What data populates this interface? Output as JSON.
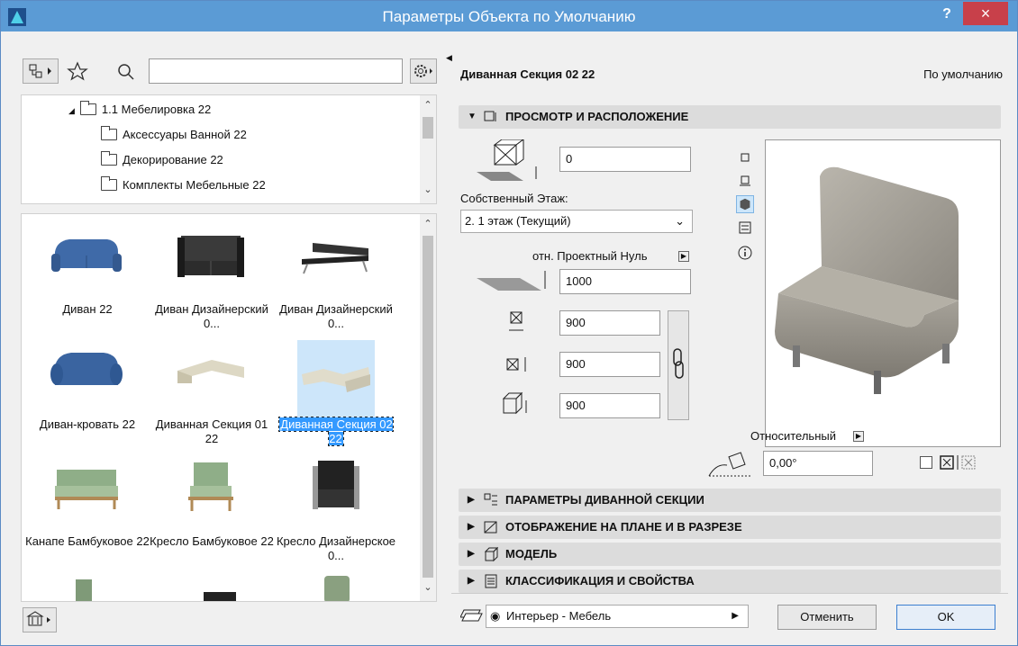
{
  "window": {
    "title": "Параметры Объекта по Умолчанию",
    "help": "?",
    "close": "×"
  },
  "library": {
    "search_value": "",
    "tree": [
      {
        "label": "1.1 Мебелировка 22",
        "expanded": true,
        "level": 0
      },
      {
        "label": "Аксессуары Ванной 22",
        "level": 1
      },
      {
        "label": "Декорирование 22",
        "level": 1
      },
      {
        "label": "Комплекты Мебельные 22",
        "level": 1
      }
    ],
    "items": [
      {
        "label": "Диван 22",
        "color": "#3f6aa8"
      },
      {
        "label": "Диван Дизайнерский 0...",
        "color": "#2c2c2c"
      },
      {
        "label": "Диван Дизайнерский 0...",
        "color": "#333333"
      },
      {
        "label": "Диван-кровать 22",
        "color": "#3a64a0"
      },
      {
        "label": "Диванная Секция 01 22",
        "color": "#ddd8c4"
      },
      {
        "label": "Диванная Секция 02 22",
        "color": "#e0dccb",
        "selected": true
      },
      {
        "label": "Канапе Бамбуковое 22",
        "color": "#8fae88"
      },
      {
        "label": "Кресло Бамбуковое 22",
        "color": "#8fae88"
      },
      {
        "label": "Кресло Дизайнерское 0...",
        "color": "#222222"
      }
    ]
  },
  "object": {
    "name": "Диванная Секция 02 22",
    "default_label": "По умолчанию",
    "section_placement": "ПРОСМОТР И РАСПОЛОЖЕНИЕ",
    "elevation_value": "0",
    "home_story_label": "Собственный Этаж:",
    "home_story_value": "2. 1 этаж (Текущий)",
    "reference_label": "отн. Проектный Нуль",
    "reference_value": "1000",
    "width_value": "900",
    "depth_value": "900",
    "height_value": "900",
    "relative_label": "Относительный",
    "angle_value": "0,00°",
    "sections": [
      "ПАРАМЕТРЫ ДИВАННОЙ СЕКЦИИ",
      "ОТОБРАЖЕНИЕ НА ПЛАНЕ И В РАЗРЕЗЕ",
      "МОДЕЛЬ",
      "КЛАССИФИКАЦИЯ И СВОЙСТВА"
    ]
  },
  "footer": {
    "layer_value": "Интерьер - Мебель",
    "cancel": "Отменить",
    "ok": "OK"
  }
}
